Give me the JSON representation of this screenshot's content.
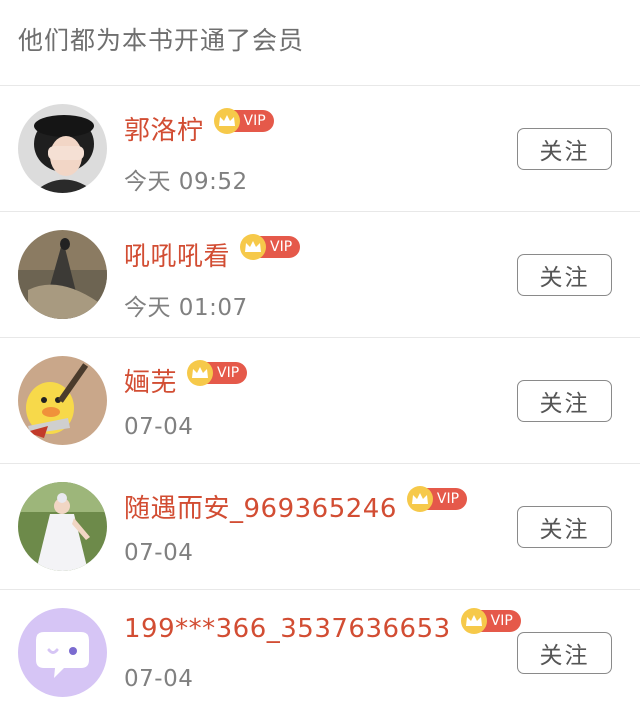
{
  "header": {
    "title": "他们都为本书开通了会员"
  },
  "members": [
    {
      "name": "郭洛柠",
      "time": "今天 09:52",
      "vip_label": "VIP",
      "follow_label": "关注",
      "avatar": "avatar-girl-cap"
    },
    {
      "name": "吼吼吼看",
      "time": "今天 01:07",
      "vip_label": "VIP",
      "follow_label": "关注",
      "avatar": "avatar-painting"
    },
    {
      "name": "婳芜",
      "time": "07-04",
      "vip_label": "VIP",
      "follow_label": "关注",
      "avatar": "avatar-duck"
    },
    {
      "name": "随遇而安_969365246",
      "time": "07-04",
      "vip_label": "VIP",
      "follow_label": "关注",
      "avatar": "avatar-bride"
    },
    {
      "name": "199***366_3537636653",
      "time": "07-04",
      "vip_label": "VIP",
      "follow_label": "关注",
      "avatar": "avatar-default-chat"
    }
  ],
  "colors": {
    "name": "#d24d33",
    "vip_tag": "#e5594a",
    "vip_crown": "#f6c94a",
    "default_avatar": "#d6c5f5"
  }
}
